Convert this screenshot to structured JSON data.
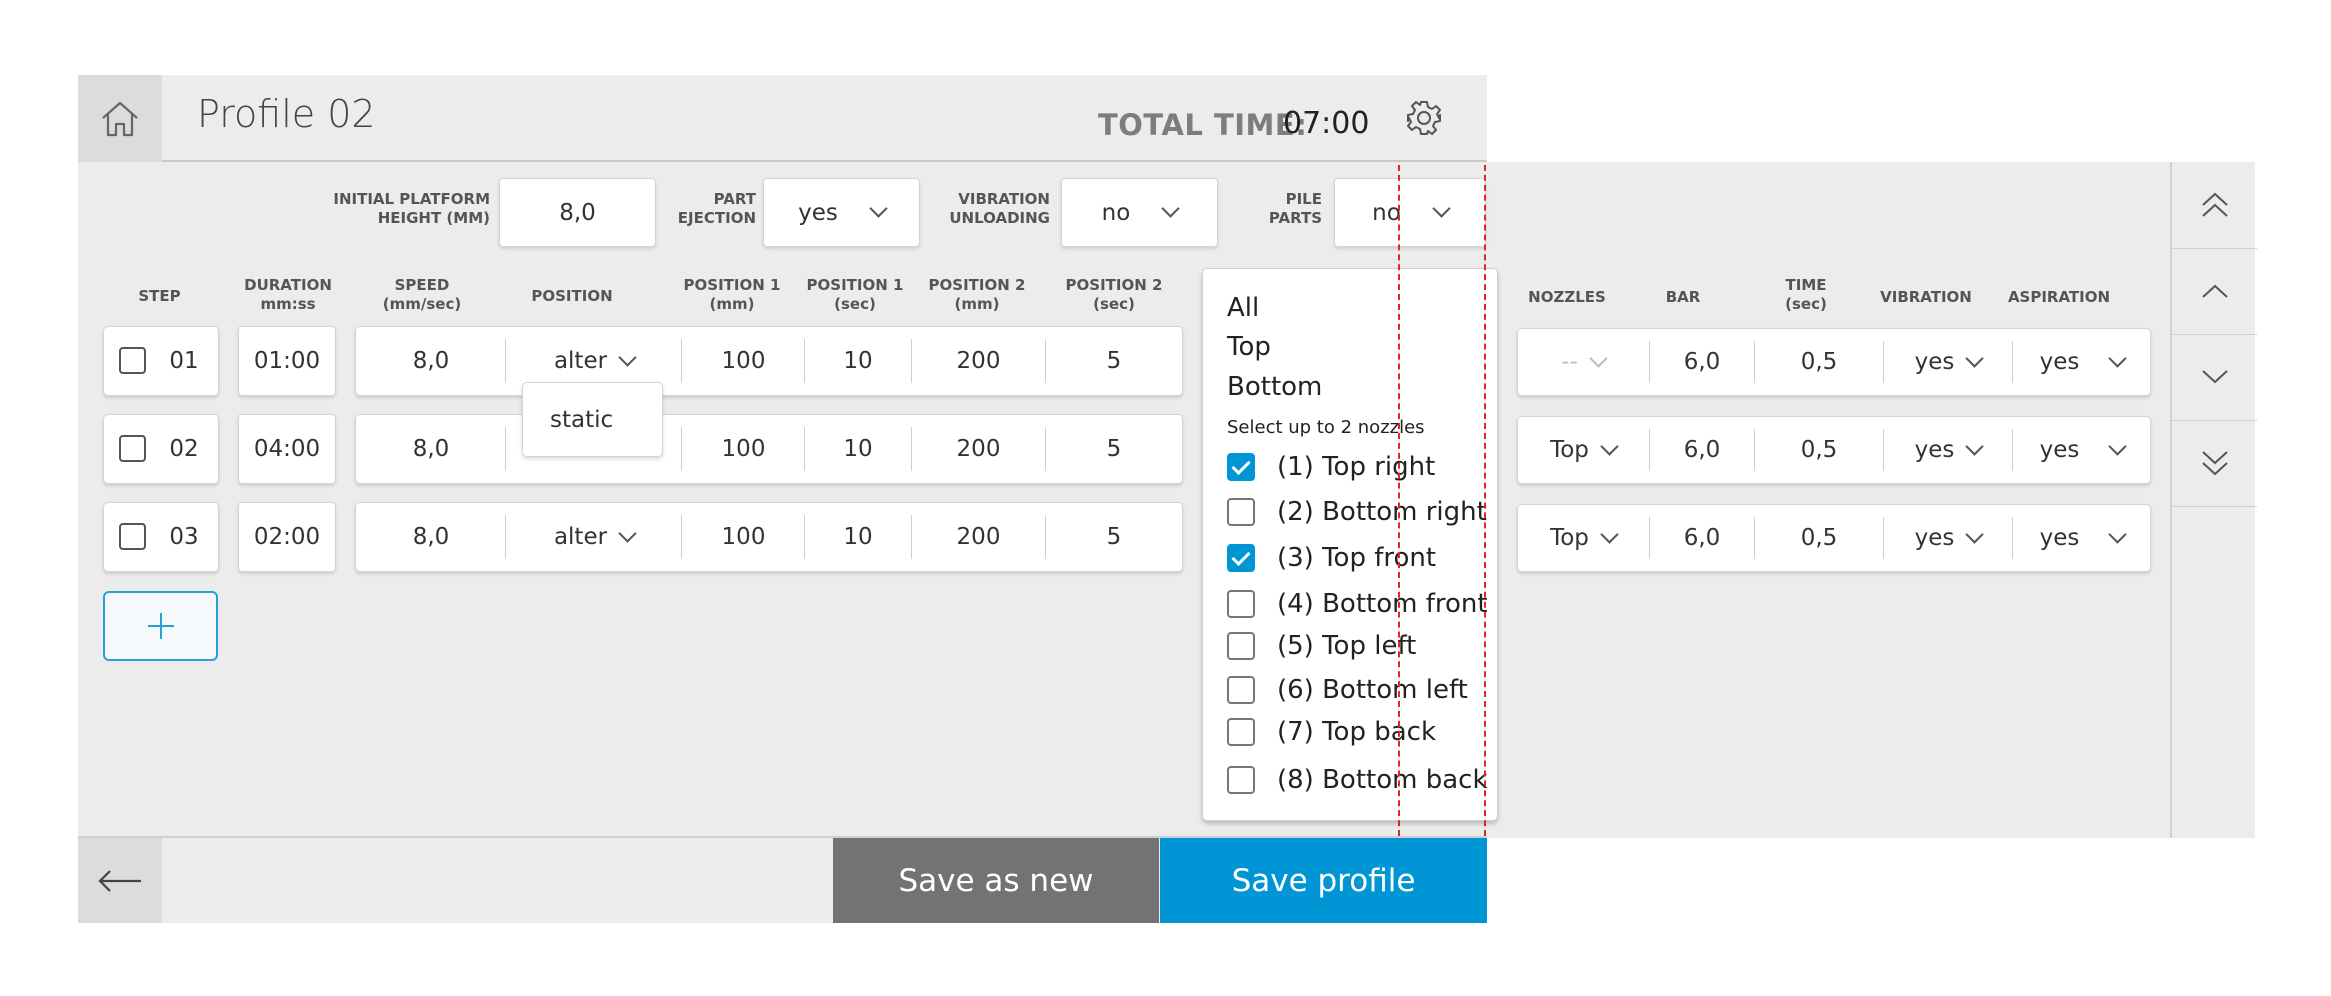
{
  "header": {
    "title": "Profile 02",
    "total_time_label": "TOTAL TIME:",
    "total_time_value": "07:00",
    "home_icon": "home-icon",
    "settings_icon": "gear-icon"
  },
  "settings": {
    "initial_platform_height_label": "INITIAL PLATFORM HEIGHT (mm)",
    "initial_platform_height_label_l1": "INITIAL PLATFORM",
    "initial_platform_height_label_l2": "HEIGHT (mm)",
    "initial_platform_height_value": "8,0",
    "part_ejection_label_l1": "PART",
    "part_ejection_label_l2": "EJECTION",
    "part_ejection_value": "yes",
    "vibration_unloading_label_l1": "VIBRATION",
    "vibration_unloading_label_l2": "UNLOADING",
    "vibration_unloading_value": "no",
    "pile_parts_label_l1": "PILE",
    "pile_parts_label_l2": "PARTS",
    "pile_parts_value": "no"
  },
  "columns": {
    "step": "STEP",
    "duration_l1": "DURATION",
    "duration_l2": "mm:ss",
    "speed_l1": "SPEED",
    "speed_l2": "(mm/sec)",
    "position": "POSITION",
    "position1_mm_l1": "POSITION 1",
    "position1_mm_l2": "(mm)",
    "position1_sec_l1": "POSITION 1",
    "position1_sec_l2": "(sec)",
    "position2_mm_l1": "POSITION 2",
    "position2_mm_l2": "(mm)",
    "position2_sec_l1": "POSITION 2",
    "position2_sec_l2": "(sec)",
    "nozzles": "NOZZLES",
    "bar": "BAR",
    "time_l1": "TIME",
    "time_l2": "(sec)",
    "vibration": "VIBRATION",
    "aspiration": "ASPIRATION"
  },
  "rows": [
    {
      "step": "01",
      "duration": "01:00",
      "speed": "8,0",
      "position": "alter",
      "p1mm": "100",
      "p1sec": "10",
      "p2mm": "200",
      "p2sec": "5",
      "nozzles": "--",
      "bar": "6,0",
      "time": "0,5",
      "vibration": "yes",
      "aspiration": "yes"
    },
    {
      "step": "02",
      "duration": "04:00",
      "speed": "8,0",
      "position": "",
      "p1mm": "100",
      "p1sec": "10",
      "p2mm": "200",
      "p2sec": "5",
      "nozzles": "Top",
      "bar": "6,0",
      "time": "0,5",
      "vibration": "yes",
      "aspiration": "yes"
    },
    {
      "step": "03",
      "duration": "02:00",
      "speed": "8,0",
      "position": "alter",
      "p1mm": "100",
      "p1sec": "10",
      "p2mm": "200",
      "p2sec": "5",
      "nozzles": "Top",
      "bar": "6,0",
      "time": "0,5",
      "vibration": "yes",
      "aspiration": "yes"
    }
  ],
  "position_popup_option": "static",
  "nozzle_dropdown": {
    "groups": [
      "All",
      "Top",
      "Bottom"
    ],
    "note": "Select up to 2 nozzles",
    "options": [
      {
        "label": "(1) Top right",
        "checked": true
      },
      {
        "label": "(2) Bottom right",
        "checked": false
      },
      {
        "label": "(3) Top front",
        "checked": true
      },
      {
        "label": "(4) Bottom front",
        "checked": false
      },
      {
        "label": "(5) Top left",
        "checked": false
      },
      {
        "label": "(6) Bottom left",
        "checked": false
      },
      {
        "label": "(7) Top back",
        "checked": false
      },
      {
        "label": "(8) Bottom back",
        "checked": false
      }
    ]
  },
  "footer": {
    "back_icon": "arrow-left-icon",
    "save_as_new": "Save as new",
    "save_profile": "Save profile"
  },
  "colors": {
    "accent": "#0096d6",
    "save_as_new_bg": "#737373",
    "panel_bg": "#ececec"
  }
}
